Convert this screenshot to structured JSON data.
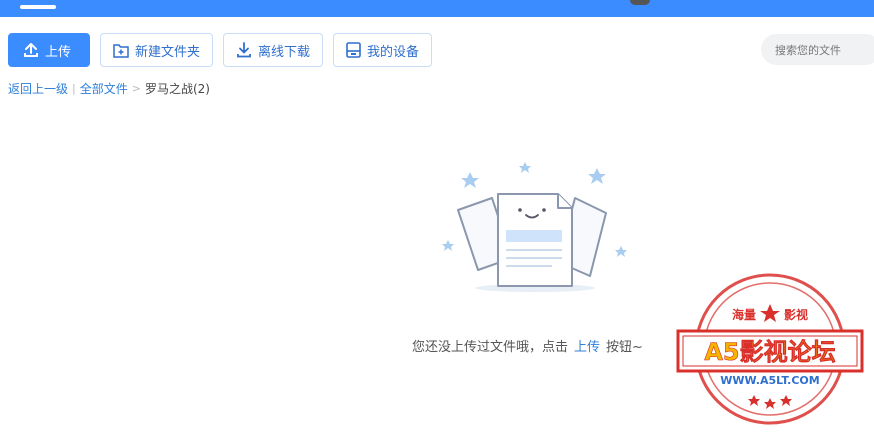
{
  "toolbar": {
    "upload_label": "上传",
    "new_folder_label": "新建文件夹",
    "offline_download_label": "离线下载",
    "my_devices_label": "我的设备"
  },
  "search": {
    "placeholder": "搜索您的文件"
  },
  "breadcrumb": {
    "back_label": "返回上一级",
    "divider": "|",
    "all_files_label": "全部文件",
    "chevron": ">",
    "current_label": "罗马之战(2)"
  },
  "empty_state": {
    "message_prefix": "您还没上传过文件哦，点击",
    "link_label": "上传",
    "message_suffix": "按钮~"
  },
  "watermark": {
    "top_left": "海量",
    "top_right": "影视",
    "main": "A5影视论坛",
    "url": "WWW.A5LT.COM"
  },
  "colors": {
    "accent": "#3b8cff",
    "link": "#2f80d9",
    "stamp_red": "#d9302c",
    "stamp_gold": "#f5b400"
  }
}
